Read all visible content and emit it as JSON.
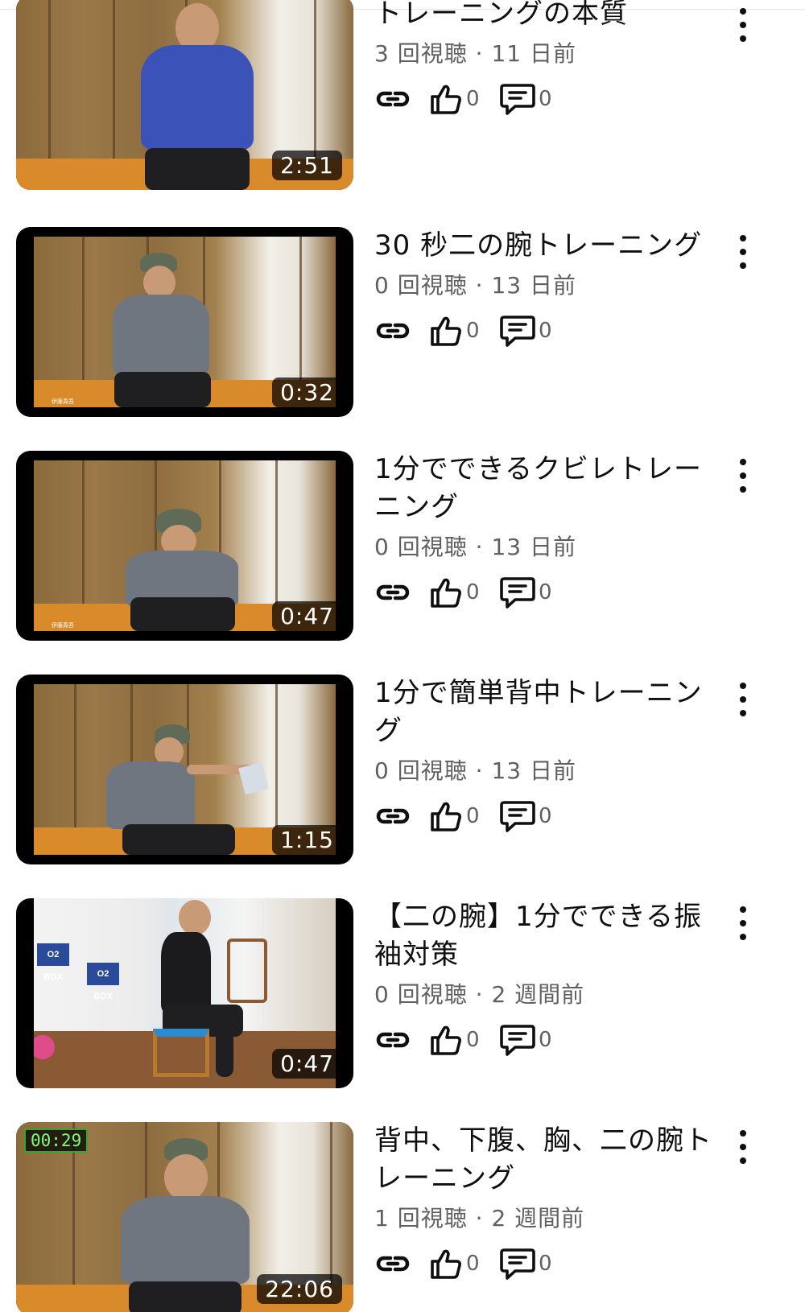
{
  "videos": [
    {
      "title": "トレーニングの本質",
      "views": "3 回視聴",
      "age": "11 日前",
      "duration": "2:51",
      "likes": "0",
      "comments": "0",
      "scene": "room-full"
    },
    {
      "title": "30 秒二の腕トレーニング",
      "views": "0 回視聴",
      "age": "13 日前",
      "duration": "0:32",
      "likes": "0",
      "comments": "0",
      "scene": "room-framed"
    },
    {
      "title": "1分でできるクビレトレーニング",
      "views": "0 回視聴",
      "age": "13 日前",
      "duration": "0:47",
      "likes": "0",
      "comments": "0",
      "scene": "room-framed"
    },
    {
      "title": "1分で簡単背中トレーニング",
      "views": "0 回視聴",
      "age": "13 日前",
      "duration": "1:15",
      "likes": "0",
      "comments": "0",
      "scene": "room-framed"
    },
    {
      "title": "【二の腕】1分でできる振袖対策",
      "views": "0 回視聴",
      "age": "2 週間前",
      "duration": "0:47",
      "likes": "0",
      "comments": "0",
      "scene": "gym",
      "sign_text": "O2 BOX"
    },
    {
      "title": "背中、下腹、胸、二の腕トレーニング",
      "views": "1 回視聴",
      "age": "2 週間前",
      "duration": "22:06",
      "timer": "00:29",
      "likes": "0",
      "comments": "0",
      "scene": "room-full"
    }
  ],
  "colors": {
    "meta_text": "#606060",
    "title_text": "#0f0f0f",
    "timer_green": "#7cff7c"
  },
  "icons": {
    "share": "link-icon",
    "like": "thumbs-up-icon",
    "comment": "comment-icon",
    "menu": "more-vert-icon"
  }
}
